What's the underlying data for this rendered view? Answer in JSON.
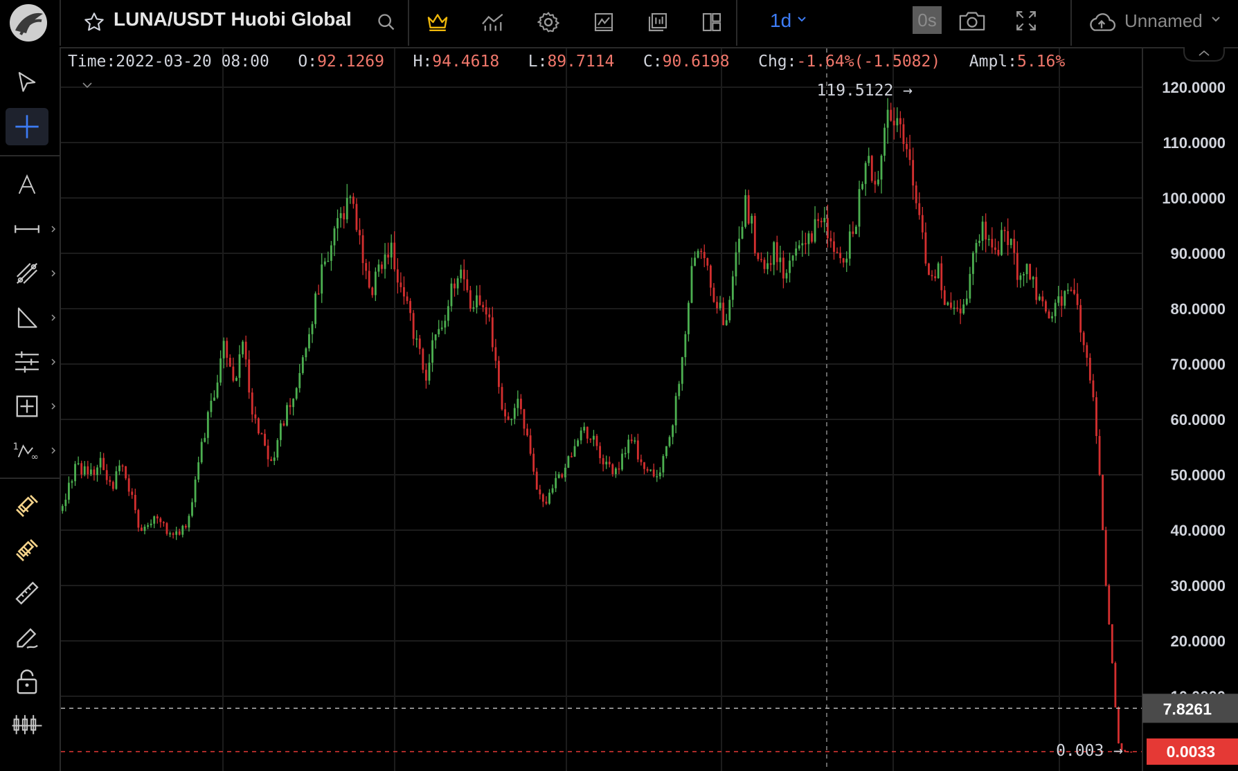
{
  "header": {
    "symbol": "LUNA/USDT Huobi Global",
    "interval": "1d",
    "countdown": "0s",
    "layout_name": "Unnamed",
    "icons": [
      "logo-icon",
      "star-icon",
      "search-icon",
      "crown-icon",
      "indicators-icon",
      "settings-icon",
      "chart-type-icon",
      "compare-icon",
      "layout-icon",
      "chevron-down-icon",
      "camera-icon",
      "fullscreen-icon",
      "cloud-icon"
    ]
  },
  "left_toolbar": {
    "icons": [
      "cursor-icon",
      "crosshair-icon",
      "text-icon",
      "trend-line-icon",
      "pitchfork-icon",
      "triangle-icon",
      "parallel-lines-icon",
      "measure-box-icon",
      "fib-icon",
      "magnet-icon",
      "magnet-strong-icon",
      "ruler-icon",
      "brush-icon",
      "lock-icon",
      "candles-icon"
    ]
  },
  "legend": {
    "time_label": "Time:",
    "time": "2022-03-20 08:00",
    "open_label": "O:",
    "open": "92.1269",
    "high_label": "H:",
    "high": "94.4618",
    "low_label": "L:",
    "low": "89.7114",
    "close_label": "C:",
    "close": "90.6198",
    "chg_label": "Chg:",
    "chg": "-1.64%(-1.5082)",
    "ampl_label": "Ampl:",
    "ampl": "5.16%"
  },
  "colors": {
    "up": "#4caf50",
    "down": "#d32f2f",
    "text_down": "#f0776b",
    "accent": "#3d7cf5",
    "grid": "#1c1c1c"
  },
  "chart_data": {
    "type": "candlestick",
    "ylim": [
      -3.5,
      127
    ],
    "y_ticks": [
      "120.0000",
      "110.0000",
      "100.0000",
      "90.0000",
      "80.0000",
      "70.0000",
      "60.0000",
      "50.0000",
      "40.0000",
      "30.0000",
      "20.0000",
      "10.0000"
    ],
    "y_tick_values": [
      120,
      110,
      100,
      90,
      80,
      70,
      60,
      50,
      40,
      30,
      20,
      10
    ],
    "max_marker": {
      "label": "119.5122",
      "value": 119.5122
    },
    "min_marker": {
      "label": "0.003",
      "value": 0.003
    },
    "last_price": {
      "label": "0.0033",
      "value": 0.0033
    },
    "crosshair_price": {
      "label": "7.8261",
      "value": 7.8261
    },
    "anchors": [
      [
        0,
        45
      ],
      [
        2,
        48
      ],
      [
        4,
        51
      ],
      [
        8,
        51
      ],
      [
        10,
        49
      ],
      [
        12,
        53
      ],
      [
        14,
        50
      ],
      [
        16,
        48
      ],
      [
        18,
        52
      ],
      [
        20,
        50
      ],
      [
        24,
        41
      ],
      [
        27,
        40
      ],
      [
        30,
        43
      ],
      [
        33,
        40
      ],
      [
        36,
        39
      ],
      [
        40,
        42
      ],
      [
        44,
        55
      ],
      [
        48,
        65
      ],
      [
        51,
        73
      ],
      [
        54,
        66
      ],
      [
        57,
        74
      ],
      [
        60,
        62
      ],
      [
        63,
        57
      ],
      [
        66,
        52
      ],
      [
        70,
        60
      ],
      [
        74,
        66
      ],
      [
        78,
        74
      ],
      [
        82,
        88
      ],
      [
        85,
        92
      ],
      [
        89,
        98
      ],
      [
        92,
        100
      ],
      [
        95,
        88
      ],
      [
        98,
        84
      ],
      [
        101,
        88
      ],
      [
        104,
        90
      ],
      [
        107,
        83
      ],
      [
        110,
        78
      ],
      [
        113,
        72
      ],
      [
        115,
        68
      ],
      [
        117,
        73
      ],
      [
        120,
        77
      ],
      [
        123,
        83
      ],
      [
        126,
        86
      ],
      [
        129,
        80
      ],
      [
        132,
        82
      ],
      [
        135,
        78
      ],
      [
        138,
        65
      ],
      [
        141,
        59
      ],
      [
        144,
        63
      ],
      [
        147,
        56
      ],
      [
        150,
        48
      ],
      [
        153,
        45
      ],
      [
        156,
        49
      ],
      [
        159,
        51
      ],
      [
        162,
        55
      ],
      [
        165,
        58
      ],
      [
        168,
        56
      ],
      [
        171,
        53
      ],
      [
        174,
        50
      ],
      [
        177,
        53
      ],
      [
        180,
        57
      ],
      [
        183,
        52
      ],
      [
        186,
        50
      ],
      [
        189,
        51
      ],
      [
        191,
        54
      ],
      [
        193,
        60
      ],
      [
        195,
        66
      ],
      [
        197,
        76
      ],
      [
        199,
        86
      ],
      [
        201,
        92
      ],
      [
        204,
        87
      ],
      [
        207,
        80
      ],
      [
        210,
        78
      ],
      [
        213,
        89
      ],
      [
        216,
        100
      ],
      [
        219,
        92
      ],
      [
        222,
        87
      ],
      [
        225,
        90
      ],
      [
        228,
        86
      ],
      [
        230,
        88
      ],
      [
        233,
        91
      ],
      [
        236,
        93
      ],
      [
        239,
        95
      ],
      [
        242,
        94
      ],
      [
        245,
        91
      ],
      [
        248,
        90
      ],
      [
        251,
        96
      ],
      [
        254,
        108
      ],
      [
        257,
        101
      ],
      [
        260,
        112
      ],
      [
        262,
        115
      ],
      [
        264,
        116
      ],
      [
        266,
        110
      ],
      [
        269,
        102
      ],
      [
        271,
        96
      ],
      [
        273,
        90
      ],
      [
        275,
        84
      ],
      [
        277,
        87
      ],
      [
        279,
        82
      ],
      [
        282,
        80
      ],
      [
        285,
        79
      ],
      [
        287,
        87
      ],
      [
        289,
        93
      ],
      [
        292,
        94
      ],
      [
        295,
        90
      ],
      [
        298,
        94
      ],
      [
        300,
        92
      ],
      [
        302,
        87
      ],
      [
        305,
        88
      ],
      [
        308,
        83
      ],
      [
        311,
        79
      ],
      [
        314,
        81
      ],
      [
        317,
        83
      ],
      [
        320,
        82
      ],
      [
        322,
        76
      ],
      [
        324,
        70
      ],
      [
        326,
        64
      ],
      [
        328,
        50
      ],
      [
        330,
        30
      ],
      [
        332,
        16
      ],
      [
        333,
        8
      ],
      [
        334,
        1.5
      ],
      [
        335,
        0.3
      ],
      [
        336,
        0.05
      ],
      [
        337,
        0.01
      ],
      [
        338,
        0.003
      ]
    ]
  }
}
